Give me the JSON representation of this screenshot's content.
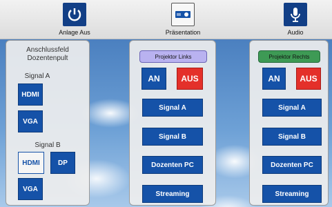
{
  "topbar": {
    "items": [
      {
        "label": "Anlage Aus",
        "icon": "power-icon"
      },
      {
        "label": "Präsentation",
        "icon": "projector-icon"
      },
      {
        "label": "Audio",
        "icon": "microphone-icon"
      }
    ]
  },
  "left_panel": {
    "title_line1": "Anschlussfeld",
    "title_line2": "Dozentenpult",
    "signal_a_label": "Signal A",
    "signal_b_label": "Signal B",
    "signal_a_buttons": [
      "HDMI",
      "VGA"
    ],
    "signal_b_buttons": [
      "HDMI",
      "DP",
      "VGA"
    ]
  },
  "middle_panel": {
    "title": "Projektor Links",
    "on_label": "AN",
    "off_label": "AUS",
    "buttons": [
      "Signal A",
      "Signal B",
      "Dozenten PC",
      "Streaming"
    ]
  },
  "right_panel": {
    "title": "Projektor Rechts",
    "on_label": "AN",
    "off_label": "AUS",
    "buttons": [
      "Signal A",
      "Signal B",
      "Dozenten PC",
      "Streaming"
    ]
  },
  "colors": {
    "button_blue": "#1552a8",
    "off_red": "#e4302a",
    "left_title_pill": "#b9b2f0",
    "right_title_pill": "#3e9a55"
  }
}
